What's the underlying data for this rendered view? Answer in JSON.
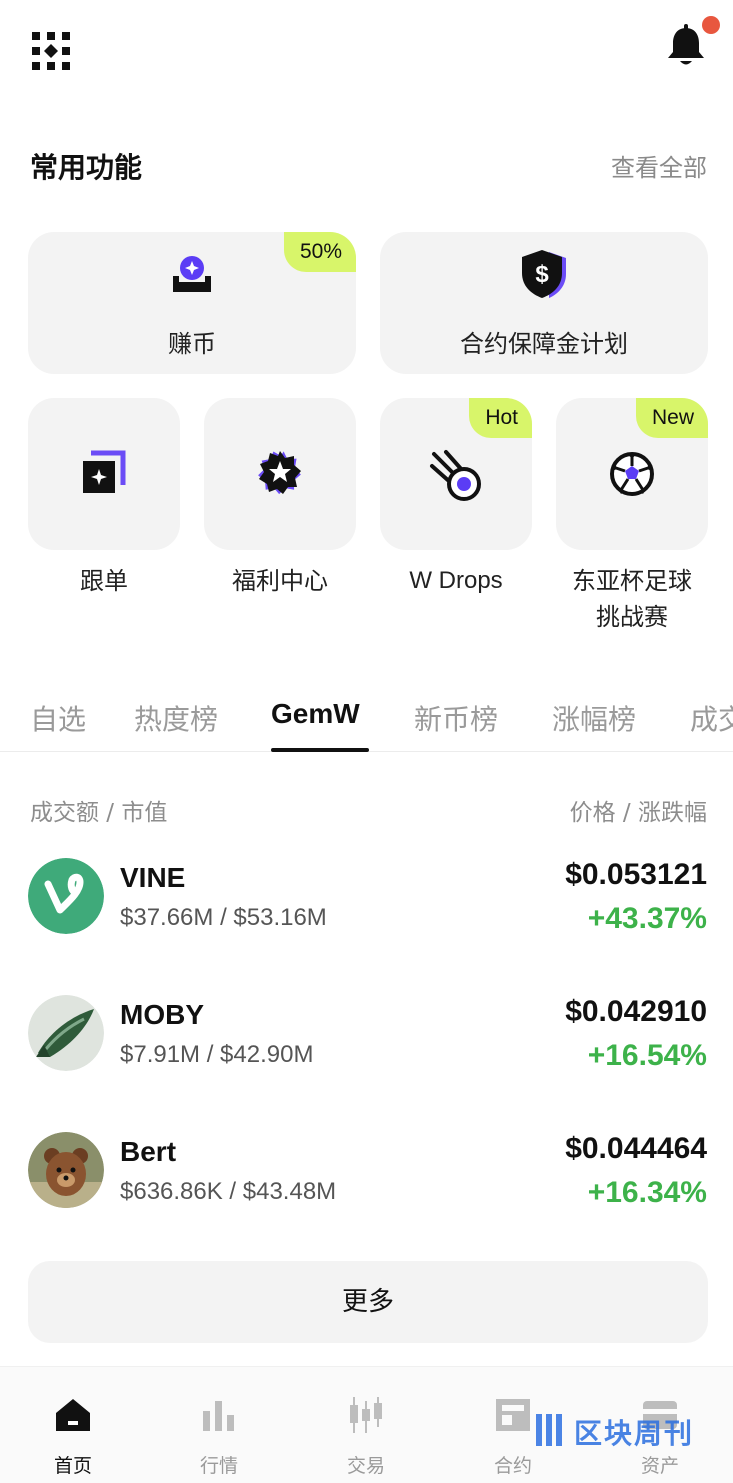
{
  "header": {
    "menu_icon": "grid-menu-icon",
    "bell_icon": "bell-icon",
    "notification_dot_color": "#e8573f"
  },
  "features": {
    "title": "常用功能",
    "view_all": "查看全部",
    "big_cards": [
      {
        "label": "赚币",
        "badge": "50%",
        "icon": "earn-icon"
      },
      {
        "label": "合约保障金计划",
        "badge": "",
        "icon": "shield-dollar-icon"
      }
    ],
    "small_cards": [
      {
        "label": "跟单",
        "badge": "",
        "icon": "copy-trade-icon"
      },
      {
        "label": "福利中心",
        "badge": "",
        "icon": "star-badge-icon"
      },
      {
        "label": "W Drops",
        "badge": "Hot",
        "icon": "meteor-icon"
      },
      {
        "label": "东亚杯足球挑战赛",
        "label_line1": "东亚杯足球",
        "label_line2": "挑战赛",
        "badge": "New",
        "icon": "soccer-ball-icon"
      }
    ],
    "badge_color": "#d8f56a"
  },
  "tabs": {
    "items": [
      "自选",
      "热度榜",
      "GemW",
      "新币榜",
      "涨幅榜",
      "成交"
    ],
    "active": "GemW"
  },
  "market": {
    "header_left": "成交额 / 市值",
    "header_right": "价格 / 涨跌幅",
    "rows": [
      {
        "name": "VINE",
        "volume": "$37.66M / $53.16M",
        "price": "$0.053121",
        "change": "+43.37%"
      },
      {
        "name": "MOBY",
        "volume": "$7.91M / $42.90M",
        "price": "$0.042910",
        "change": "+16.54%"
      },
      {
        "name": "Bert",
        "volume": "$636.86K / $43.48M",
        "price": "$0.044464",
        "change": "+16.34%"
      }
    ],
    "positive_color": "#3db24a",
    "more_label": "更多"
  },
  "navbar": {
    "items": [
      {
        "label": "首页",
        "icon": "home-icon",
        "active": true
      },
      {
        "label": "行情",
        "icon": "market-bars-icon",
        "active": false
      },
      {
        "label": "交易",
        "icon": "candlestick-icon",
        "active": false
      },
      {
        "label": "合约",
        "icon": "futures-icon",
        "active": false
      },
      {
        "label": "资产",
        "icon": "wallet-icon",
        "active": false
      }
    ]
  },
  "watermark": {
    "text": "区块周刊"
  }
}
